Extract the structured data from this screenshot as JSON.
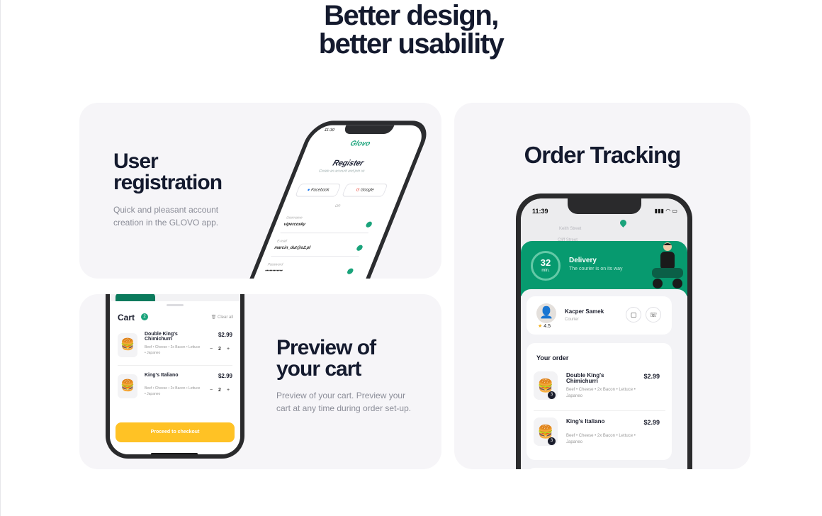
{
  "headline": {
    "line1": "Better design,",
    "line2": "better usability"
  },
  "registration": {
    "title_line1": "User",
    "title_line2": "registration",
    "description": "Quick and pleasant account creation in the GLOVO app.",
    "phone": {
      "time": "11:39",
      "logo": "Glovo",
      "heading": "Register",
      "subheading": "Create an account and join us",
      "facebook_label": "Facebook",
      "google_label": "Google",
      "or_label": "OR",
      "fields": [
        {
          "label": "Username",
          "value": "vipercosky"
        },
        {
          "label": "E-mail",
          "value": "marcin_dut@o2.pl"
        },
        {
          "label": "Password",
          "value": "••••••••••••"
        }
      ]
    }
  },
  "cart": {
    "title_line1": "Preview of",
    "title_line2": "your cart",
    "description": "Preview of your cart. Preview your cart at any time during order set-up.",
    "phone": {
      "cart_label": "Cart",
      "cart_count": "2",
      "clear_label": "Clear all",
      "items": [
        {
          "name": "Double King's Chimichurri",
          "ingredients": "Beef • Cheese • 2x Bacon • Lettuce • Japaneo",
          "price": "$2.99",
          "qty": "2"
        },
        {
          "name": "King's Italiano",
          "ingredients": "Beef • Cheese • 2x Bacon • Lettuce • Japaneo",
          "price": "$2.99",
          "qty": "2"
        }
      ],
      "checkout_label": "Proceed to checkout"
    }
  },
  "tracking": {
    "title": "Order Tracking",
    "phone": {
      "time": "11:39",
      "streets": [
        "Keith Street",
        "Cliff Street"
      ],
      "minutes": "32",
      "minutes_unit": "min.",
      "delivery_title": "Delivery",
      "delivery_subtitle": "The courier is on its way",
      "courier_name": "Kacper Samek",
      "courier_role": "Courier",
      "courier_rating": "4.5",
      "order_heading": "Your order",
      "items": [
        {
          "name": "Double King's Chimichurri",
          "ingredients": "Beef • Cheese • 2x Bacon • Lettuce • Japaneo",
          "price": "$2.99",
          "qty": "3"
        },
        {
          "name": "King's Italiano",
          "ingredients": "Beef • Cheese • 2x Bacon • Lettuce • Japaneo",
          "price": "$2.99",
          "qty": "3"
        }
      ]
    }
  },
  "colors": {
    "brand_green": "#079a6f",
    "accent_yellow": "#ffc225",
    "card_bg": "#f6f5f8",
    "text_dark": "#141a2e"
  }
}
